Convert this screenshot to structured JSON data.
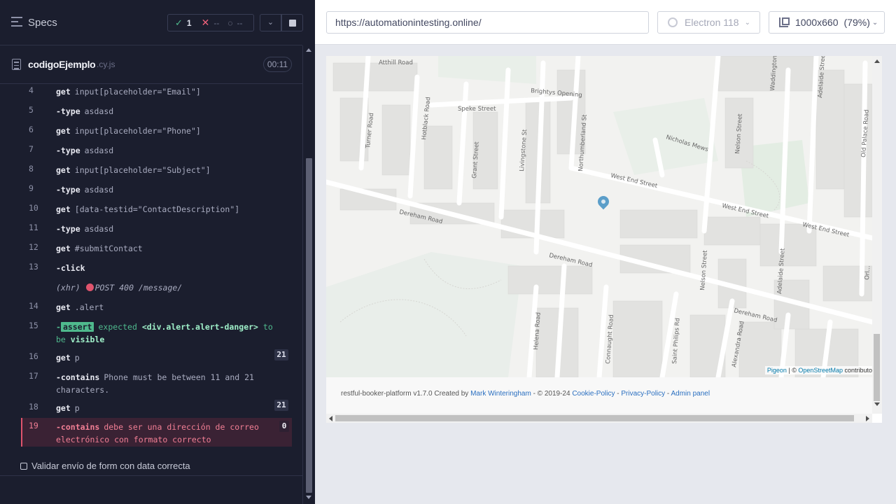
{
  "specs_panel": {
    "title": "Specs",
    "stats": {
      "passed": "1",
      "failed": "--",
      "pending": "--"
    },
    "file": {
      "name": "codigoEjemplo",
      "ext": ".cy.js",
      "duration": "00:11"
    },
    "commands": [
      {
        "num": "4",
        "name": "get",
        "message": "input[placeholder=\"Email\"]"
      },
      {
        "num": "5",
        "name": "-type",
        "message": "asdasd"
      },
      {
        "num": "6",
        "name": "get",
        "message": "input[placeholder=\"Phone\"]"
      },
      {
        "num": "7",
        "name": "-type",
        "message": "asdasd"
      },
      {
        "num": "8",
        "name": "get",
        "message": "input[placeholder=\"Subject\"]"
      },
      {
        "num": "9",
        "name": "-type",
        "message": "asdasd"
      },
      {
        "num": "10",
        "name": "get",
        "message": "[data-testid=\"ContactDescription\"]"
      },
      {
        "num": "11",
        "name": "-type",
        "message": "asdasd"
      },
      {
        "num": "12",
        "name": "get",
        "message": "#submitContact"
      },
      {
        "num": "13",
        "name": "-click",
        "message": ""
      },
      {
        "num": "",
        "name": "(xhr)",
        "message": "POST 400 /message/"
      },
      {
        "num": "14",
        "name": "get",
        "message": ".alert"
      },
      {
        "num": "15",
        "name": "assert",
        "message_prefix": "expected",
        "message_subject": "<div.alert.alert-danger>",
        "message_rest": "to be",
        "message_end": "visible"
      },
      {
        "num": "16",
        "name": "get",
        "message": "p",
        "badge": "21"
      },
      {
        "num": "17",
        "name": "-contains",
        "message": "Phone must be between 11 and 21 characters."
      },
      {
        "num": "18",
        "name": "get",
        "message": "p",
        "badge": "21"
      },
      {
        "num": "19",
        "name": "-contains",
        "message": "debe ser una dirección de correo electrónico con formato correcto",
        "badge": "0"
      }
    ],
    "next_test": "Validar envío de form con data correcta"
  },
  "browser_bar": {
    "url": "https://automationintesting.online/",
    "browser": "Electron 118",
    "viewport": "1000x660",
    "zoom": "(79%)"
  },
  "map": {
    "streets": [
      "Atthill Road",
      "Brightys Opening",
      "Speke Street",
      "Turner Road",
      "Hotblack Road",
      "Grant Street",
      "Livingstone St",
      "Northumberland St",
      "Nicholas Mews",
      "Nelson Street",
      "West End Street",
      "Waddington",
      "Adelaide Street",
      "Old Palace Road",
      "Dereham Road",
      "Helena Road",
      "Connaught Road",
      "Saint Philips Rd",
      "Alexandra Road",
      "Nelson Street",
      "Adelaide Street",
      "Orl..."
    ],
    "attribution_pre": "",
    "attribution_link1": "Pigeon",
    "attribution_sep": " | © ",
    "attribution_link2": "OpenStreetMap",
    "attribution_post": " contributo"
  },
  "footer": {
    "text": "restful-booker-platform v1.7.0 Created by ",
    "author": "Mark Winteringham",
    "copyright": " - © 2019-24 ",
    "cookie": "Cookie-Policy",
    "sep1": " - ",
    "privacy": "Privacy-Policy",
    "sep2": " - ",
    "admin": "Admin panel"
  },
  "colors": {
    "panel_bg": "#1b1e2e",
    "pass": "#4fb98d",
    "fail": "#e0546d",
    "link": "#2a6fc0"
  }
}
